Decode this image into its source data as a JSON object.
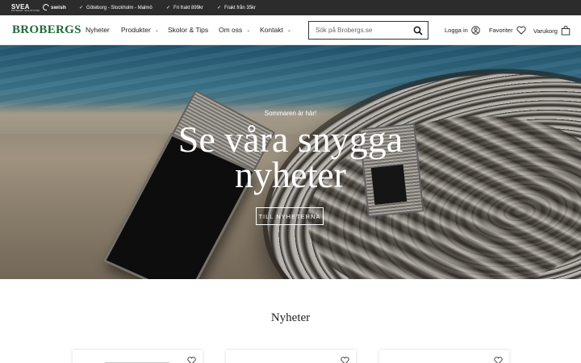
{
  "topbar": {
    "payment": {
      "svea": "SVEA",
      "svea_sub": "PAYMENT SOLUTIONS",
      "swish": "swish"
    },
    "usps": [
      "Göteborg - Stockholm - Malmö",
      "Fri frakt 899kr",
      "Frakt från 35kr"
    ]
  },
  "header": {
    "logo": "BROBERGS",
    "nav": [
      "Nyheter",
      "Produkter",
      "Skolor & Tips",
      "Om oss",
      "Kontakt"
    ],
    "search_placeholder": "Sök på Brobergs.se",
    "login": "Logga in",
    "favorites": "Favoriter",
    "cart": "Varukorg"
  },
  "hero": {
    "eyebrow": "Sommaren är här!",
    "title_line1": "Se våra snygga",
    "title_line2": "nyheter",
    "button": "TILL NYHETERNA"
  },
  "news": {
    "title": "Nyheter",
    "card_count_visible": 3
  },
  "colors": {
    "topbar_bg": "#2c2c2c",
    "logo": "#1f6a3a",
    "text": "#222222"
  }
}
